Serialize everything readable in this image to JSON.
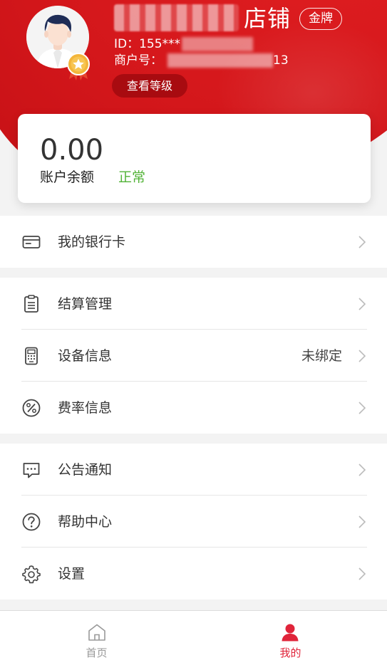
{
  "header": {
    "shop_name_suffix": "店铺",
    "level_badge": "金牌",
    "id_prefix": "ID：155***",
    "merchant_prefix": "商户号：",
    "merchant_suffix": "13",
    "view_level_button": "查看等级"
  },
  "balance": {
    "amount": "0.00",
    "label": "账户余额",
    "status": "正常",
    "status_color": "#52b337"
  },
  "menu": {
    "bank_card": {
      "label": "我的银行卡",
      "icon": "bank-card-icon"
    },
    "settlement": {
      "label": "结算管理",
      "icon": "clipboard-icon"
    },
    "device": {
      "label": "设备信息",
      "value": "未绑定",
      "icon": "pos-terminal-icon"
    },
    "rate": {
      "label": "费率信息",
      "icon": "percent-icon"
    },
    "notice": {
      "label": "公告通知",
      "icon": "message-icon"
    },
    "help": {
      "label": "帮助中心",
      "icon": "question-icon"
    },
    "settings": {
      "label": "设置",
      "icon": "gear-icon"
    }
  },
  "tabbar": {
    "home": {
      "label": "首页",
      "icon": "home-icon",
      "color": "#999999"
    },
    "mine": {
      "label": "我的",
      "icon": "user-icon",
      "color": "#e0243a",
      "active": true
    }
  },
  "colors": {
    "brand_red": "#d4171b",
    "tab_active": "#e0243a"
  }
}
